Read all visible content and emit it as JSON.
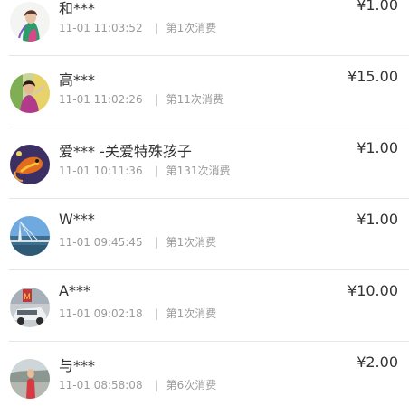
{
  "records": [
    {
      "name": "和***",
      "time": "11-01 11:03:52",
      "count": "第1次消费",
      "amount": "¥1.00"
    },
    {
      "name": "高***",
      "time": "11-01 11:02:26",
      "count": "第11次消费",
      "amount": "¥15.00"
    },
    {
      "name": "爱*** -关爱特殊孩子",
      "time": "11-01 10:11:36",
      "count": "第131次消费",
      "amount": "¥1.00"
    },
    {
      "name": "W***",
      "time": "11-01 09:45:45",
      "count": "第1次消费",
      "amount": "¥1.00"
    },
    {
      "name": "A***",
      "time": "11-01 09:02:18",
      "count": "第1次消费",
      "amount": "¥10.00"
    },
    {
      "name": "与***",
      "time": "11-01 08:58:08",
      "count": "第6次消费",
      "amount": "¥2.00"
    }
  ],
  "separator": "|"
}
